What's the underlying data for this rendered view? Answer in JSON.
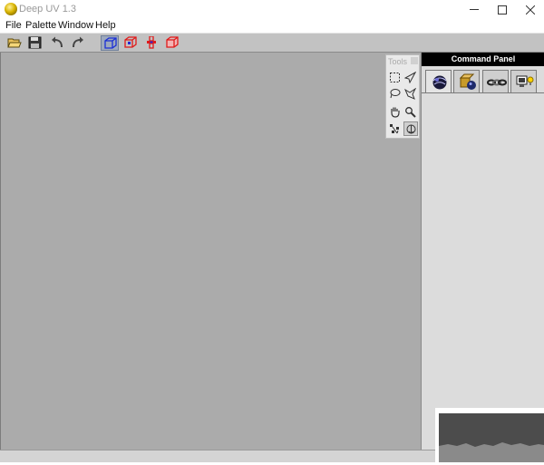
{
  "window": {
    "title": "Deep UV 1.3",
    "controls": [
      "minimize",
      "maximize",
      "close"
    ]
  },
  "menu": {
    "items": [
      "File",
      "Palette",
      "Window",
      "Help"
    ]
  },
  "toolbar": {
    "buttons": [
      {
        "name": "open-icon",
        "active": false
      },
      {
        "name": "save-icon",
        "active": false
      },
      {
        "name": "undo-icon",
        "active": false
      },
      {
        "name": "redo-icon",
        "active": false
      },
      {
        "name": "cube-view-blue-icon",
        "active": true
      },
      {
        "name": "cube-view-red-1-icon",
        "active": false
      },
      {
        "name": "cube-view-red-2-icon",
        "active": false
      },
      {
        "name": "cube-view-red-3-icon",
        "active": false
      }
    ]
  },
  "tools": {
    "title": "Tools",
    "items": [
      {
        "name": "rect-select-icon",
        "active": false
      },
      {
        "name": "polygon-select-icon",
        "active": false
      },
      {
        "name": "lasso-icon",
        "active": false
      },
      {
        "name": "freeform-select-icon",
        "active": false
      },
      {
        "name": "hand-pan-icon",
        "active": false
      },
      {
        "name": "zoom-magnifier-icon",
        "active": false
      },
      {
        "name": "move-points-icon",
        "active": false
      },
      {
        "name": "rotate-icon",
        "active": true
      }
    ]
  },
  "command_panel": {
    "title": "Command Panel",
    "tabs": [
      {
        "name": "uv-sphere-tab-icon",
        "active": true
      },
      {
        "name": "objects-tab-icon",
        "active": false
      },
      {
        "name": "chain-tab-icon",
        "active": false
      },
      {
        "name": "display-light-tab-icon",
        "active": false
      }
    ]
  },
  "colors": {
    "viewport": "#ababab",
    "toolbar": "#c2c2c2",
    "panel": "#dcdcdc",
    "panel_header": "#000000",
    "active_button": "#9ea9bd"
  }
}
